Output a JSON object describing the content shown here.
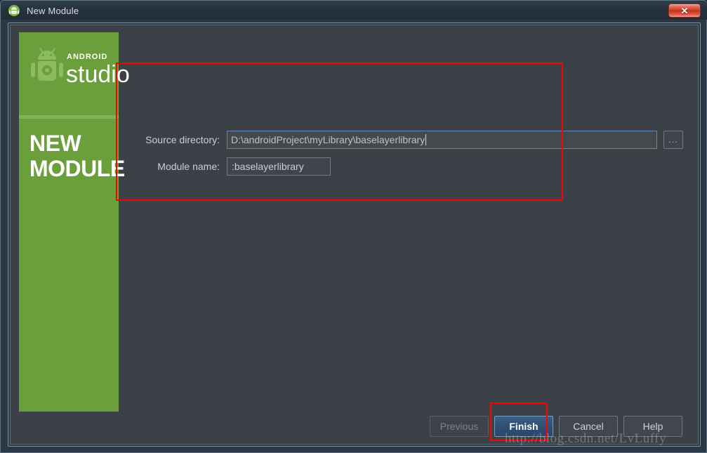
{
  "window": {
    "title": "New Module",
    "icon": "android-studio-icon",
    "close_label": "✕"
  },
  "sidebar": {
    "logo_top": "ANDROID",
    "logo_bottom": "studio",
    "heading_line1": "NEW",
    "heading_line2": "MODULE",
    "robot_icon": "android-robot-icon",
    "background_color": "#6a9f3c"
  },
  "form": {
    "source_directory": {
      "label": "Source directory:",
      "value": "D:\\androidProject\\myLibrary\\baselayerlibrary",
      "placeholder": "Source directory",
      "browse_label": "..."
    },
    "module_name": {
      "label": "Module name:",
      "value": ":baselayerlibrary",
      "placeholder": "Module name"
    }
  },
  "buttons": {
    "previous": "Previous",
    "finish": "Finish",
    "cancel": "Cancel",
    "help": "Help"
  },
  "annotations": {
    "accent_color": "#ff0000",
    "form_box": "highlight-form-area",
    "finish_box": "highlight-finish-button"
  },
  "watermark": {
    "text": "http://blog.csdn.net/LvLuffy"
  }
}
